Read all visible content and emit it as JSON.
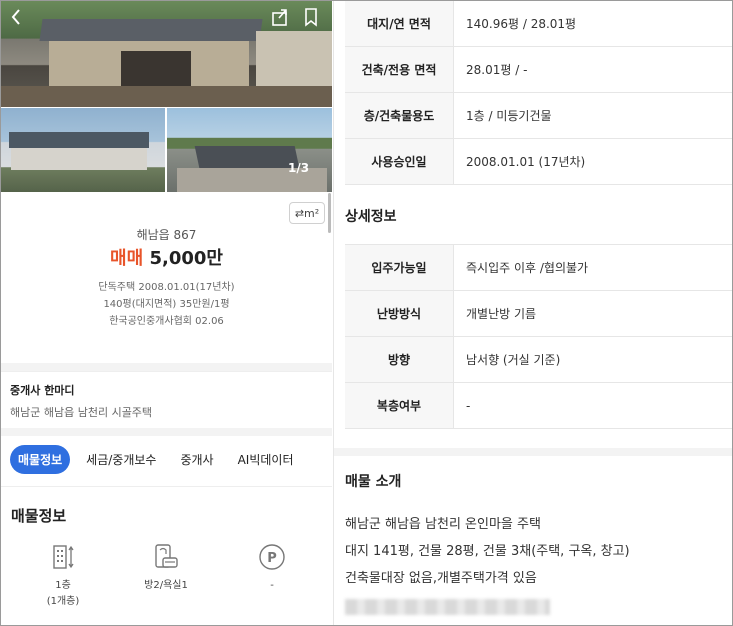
{
  "listing": {
    "photo_counter": "1/3",
    "unit_toggle": "⇄m²",
    "address_short": "해남읍 867",
    "deal_type": "매매",
    "price": "5,000만",
    "meta_line1": "단독주택  2008.01.01(17년차)",
    "meta_line2": "140평(대지면적)  35만원/1평",
    "meta_line3": "한국공인중개사협회 02.06"
  },
  "agent": {
    "title": "중개사 한마디",
    "desc": "해남군 해남읍 남천리 시골주택"
  },
  "tabs": [
    {
      "label": "매물정보",
      "active": true
    },
    {
      "label": "세금/중개보수",
      "active": false
    },
    {
      "label": "중개사",
      "active": false
    },
    {
      "label": "AI빅데이터",
      "active": false
    }
  ],
  "property_info": {
    "title": "매물정보",
    "features": [
      {
        "icon": "building-floor-icon",
        "label1": "1층",
        "label2": "(1개층)"
      },
      {
        "icon": "room-bath-icon",
        "label1": "방2/욕실1",
        "label2": ""
      },
      {
        "icon": "parking-icon",
        "label1": "-",
        "label2": ""
      }
    ]
  },
  "details_top": [
    {
      "key": "대지/연 면적",
      "value": "140.96평 / 28.01평"
    },
    {
      "key": "건축/전용 면적",
      "value": "28.01평 / -"
    },
    {
      "key": "층/건축물용도",
      "value": "1층 / 미등기건물"
    },
    {
      "key": "사용승인일",
      "value": "2008.01.01 (17년차)"
    }
  ],
  "detail_section": {
    "title": "상세정보",
    "rows": [
      {
        "key": "입주가능일",
        "value": "즉시입주 이후 /협의불가"
      },
      {
        "key": "난방방식",
        "value": "개별난방 기름"
      },
      {
        "key": "방향",
        "value": "남서향 (거실 기준)"
      },
      {
        "key": "복층여부",
        "value": "-"
      }
    ]
  },
  "intro_section": {
    "title": "매물 소개",
    "lines": [
      "해남군 해남읍 남천리 온인마을 주택",
      "대지 141평, 건물 28평, 건물 3채(주택, 구옥, 창고)",
      "건축물대장 없음,개별주택가격 있음"
    ]
  },
  "colors": {
    "accent": "#2f6fe0",
    "deal": "#e8542a"
  }
}
